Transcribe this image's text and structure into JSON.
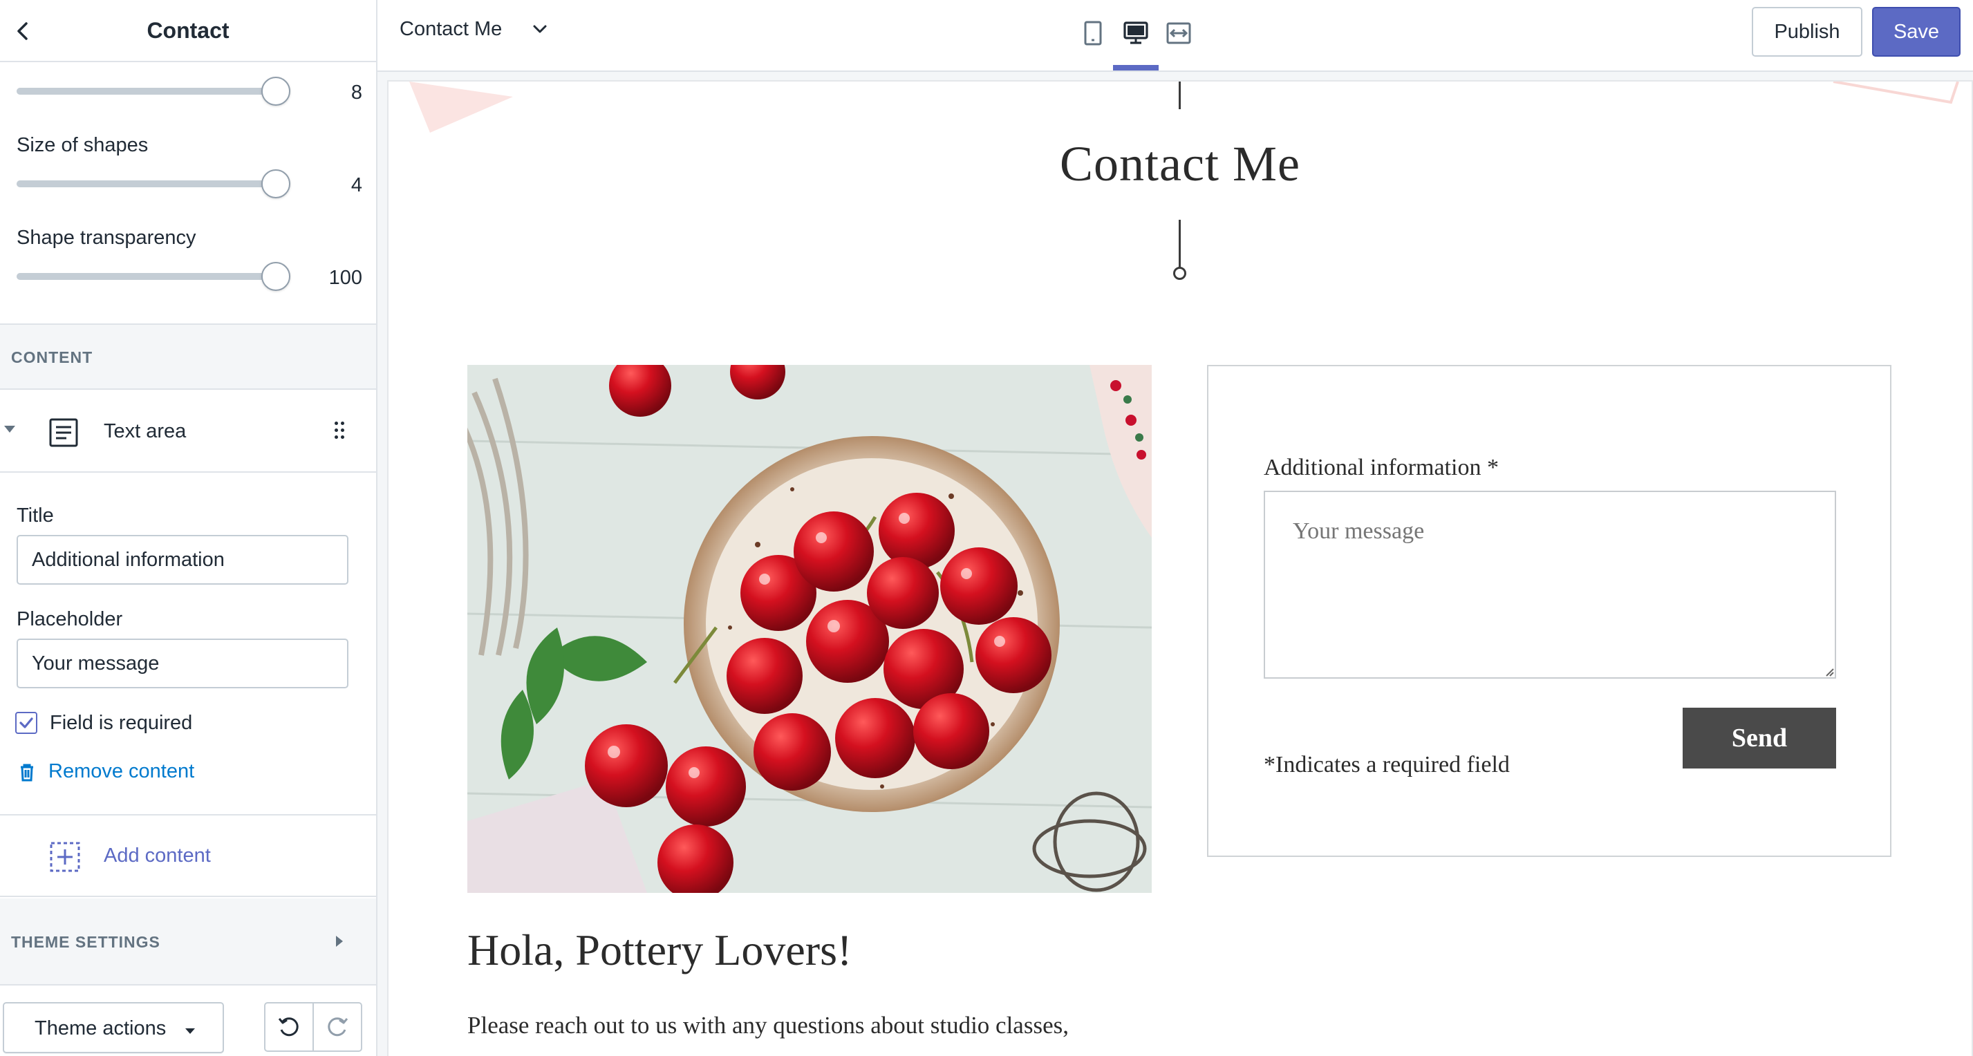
{
  "sidebar": {
    "title": "Contact",
    "sliders": [
      {
        "label": "",
        "value": "8",
        "fraction": 1.0
      },
      {
        "label": "Size of shapes",
        "value": "4",
        "fraction": 1.0
      },
      {
        "label": "Shape transparency",
        "value": "100",
        "fraction": 1.0
      }
    ],
    "content_section": "CONTENT",
    "block": {
      "label": "Text area",
      "icon": "text-block-icon"
    },
    "title_field": {
      "label": "Title",
      "value": "Additional information"
    },
    "placeholder_field": {
      "label": "Placeholder",
      "value": "Your message"
    },
    "required_checkbox": {
      "label": "Field is required",
      "checked": true
    },
    "remove_label": "Remove content",
    "add_label": "Add content",
    "theme_settings": "THEME SETTINGS",
    "theme_actions": "Theme actions"
  },
  "topbar": {
    "page_select": "Contact Me",
    "devices": [
      "mobile-icon",
      "desktop-icon",
      "fullscreen-icon"
    ],
    "active_device": "desktop",
    "publish": "Publish",
    "save": "Save"
  },
  "preview": {
    "title": "Contact Me",
    "form": {
      "label": "Additional information *",
      "placeholder": "Your message",
      "required_note": "*Indicates a required field",
      "send": "Send"
    },
    "heading": "Hola, Pottery Lovers!",
    "intro": "Please reach out to us with any questions about studio classes,"
  },
  "colors": {
    "accent": "#5c6ac4",
    "link": "#007ace",
    "send_button": "#4a4a4a",
    "cherry": "#c8102e"
  }
}
